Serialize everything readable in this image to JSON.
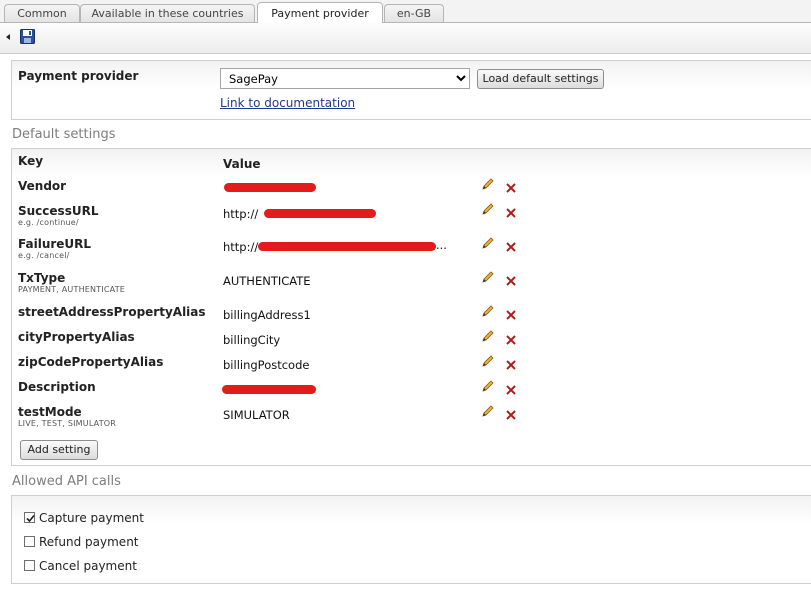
{
  "tabs": [
    {
      "label": "Common",
      "active": false
    },
    {
      "label": "Available in these countries",
      "active": false
    },
    {
      "label": "Payment provider",
      "active": true
    },
    {
      "label": "en-GB",
      "active": false
    }
  ],
  "toolbar": {
    "back_icon": "arrow-left-icon",
    "save_icon": "save-disk-icon"
  },
  "provider": {
    "label": "Payment provider",
    "selected": "SagePay",
    "load_button": "Load default settings",
    "doc_link": "Link to documentation"
  },
  "default_settings": {
    "title": "Default settings",
    "col_key": "Key",
    "col_value": "Value",
    "rows": [
      {
        "key": "Vendor",
        "hint": "",
        "value": ""
      },
      {
        "key": "SuccessURL",
        "hint": "e.g. /continue/",
        "value": "http://"
      },
      {
        "key": "FailureURL",
        "hint": "e.g. /cancel/",
        "value": "http://"
      },
      {
        "key": "TxType",
        "hint": "PAYMENT, AUTHENTICATE",
        "value": "AUTHENTICATE"
      },
      {
        "key": "streetAddressPropertyAlias",
        "hint": "",
        "value": "billingAddress1"
      },
      {
        "key": "cityPropertyAlias",
        "hint": "",
        "value": "billingCity"
      },
      {
        "key": "zipCodePropertyAlias",
        "hint": "",
        "value": "billingPostcode"
      },
      {
        "key": "Description",
        "hint": "",
        "value": ""
      },
      {
        "key": "testMode",
        "hint": "LIVE, TEST, SIMULATOR",
        "value": "SIMULATOR"
      }
    ],
    "failure_suffix": "...",
    "add_button": "Add setting",
    "edit_icon": "pencil-icon",
    "delete_icon": "delete-x-icon",
    "redaction_color": "#e31b1b"
  },
  "api_calls": {
    "title": "Allowed API calls",
    "items": [
      {
        "label": "Capture payment",
        "checked": true
      },
      {
        "label": "Refund payment",
        "checked": false
      },
      {
        "label": "Cancel payment",
        "checked": false
      }
    ]
  }
}
